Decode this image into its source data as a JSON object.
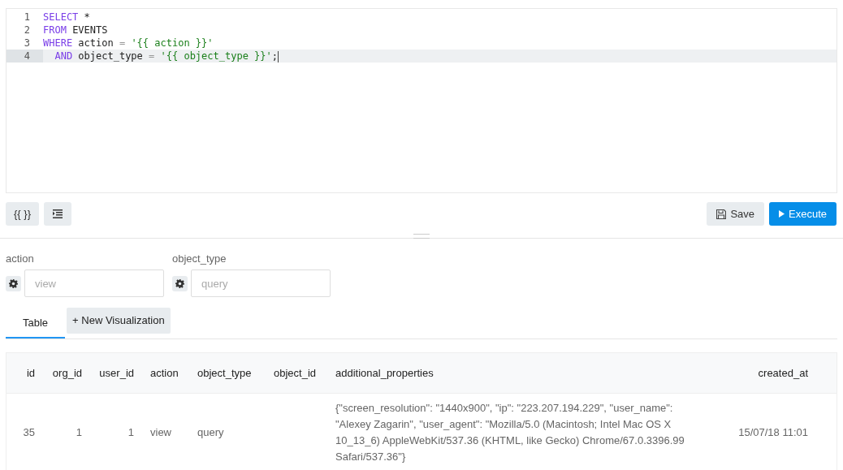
{
  "editor": {
    "lines": [
      {
        "number": "1",
        "active": false,
        "tokens": [
          {
            "kind": "keyword",
            "text": "SELECT"
          },
          {
            "kind": "plain",
            "text": " *"
          }
        ]
      },
      {
        "number": "2",
        "active": false,
        "tokens": [
          {
            "kind": "keyword",
            "text": "FROM"
          },
          {
            "kind": "plain",
            "text": " EVENTS"
          }
        ]
      },
      {
        "number": "3",
        "active": false,
        "tokens": [
          {
            "kind": "keyword",
            "text": "WHERE"
          },
          {
            "kind": "plain",
            "text": " action "
          },
          {
            "kind": "operator",
            "text": "="
          },
          {
            "kind": "string",
            "text": " '{{ action }}'"
          }
        ]
      },
      {
        "number": "4",
        "active": true,
        "tokens": [
          {
            "kind": "keyword",
            "text": "  AND"
          },
          {
            "kind": "plain",
            "text": " object_type "
          },
          {
            "kind": "operator",
            "text": "="
          },
          {
            "kind": "string",
            "text": " '{{ object_type }}'"
          },
          {
            "kind": "plain",
            "text": ";"
          }
        ]
      }
    ]
  },
  "toolbar": {
    "params_button": "{{ }}",
    "save_button": "Save",
    "execute_button": "Execute"
  },
  "parameters": [
    {
      "label": "action",
      "placeholder": "view"
    },
    {
      "label": "object_type",
      "placeholder": "query"
    }
  ],
  "tabs": [
    {
      "label": "Table",
      "selected": true
    },
    {
      "label": "+ New Visualization",
      "selected": false
    }
  ],
  "table": {
    "columns": [
      {
        "label": "id",
        "kind": "number"
      },
      {
        "label": "org_id",
        "kind": "number"
      },
      {
        "label": "user_id",
        "kind": "number"
      },
      {
        "label": "action",
        "kind": "text"
      },
      {
        "label": "object_type",
        "kind": "text"
      },
      {
        "label": "object_id",
        "kind": "text"
      },
      {
        "label": "additional_properties",
        "kind": "text"
      },
      {
        "label": "created_at",
        "kind": "date"
      }
    ],
    "rows": [
      [
        "35",
        "1",
        "1",
        "view",
        "query",
        "",
        "{\"screen_resolution\": \"1440x900\", \"ip\": \"223.207.194.229\", \"user_name\": \"Alexey Zagarin\", \"user_agent\": \"Mozilla/5.0 (Macintosh; Intel Mac OS X 10_13_6) AppleWebKit/537.36 (KHTML, like Gecko) Chrome/67.0.3396.99 Safari/537.36\"}",
        "15/07/18 11:01"
      ]
    ]
  }
}
